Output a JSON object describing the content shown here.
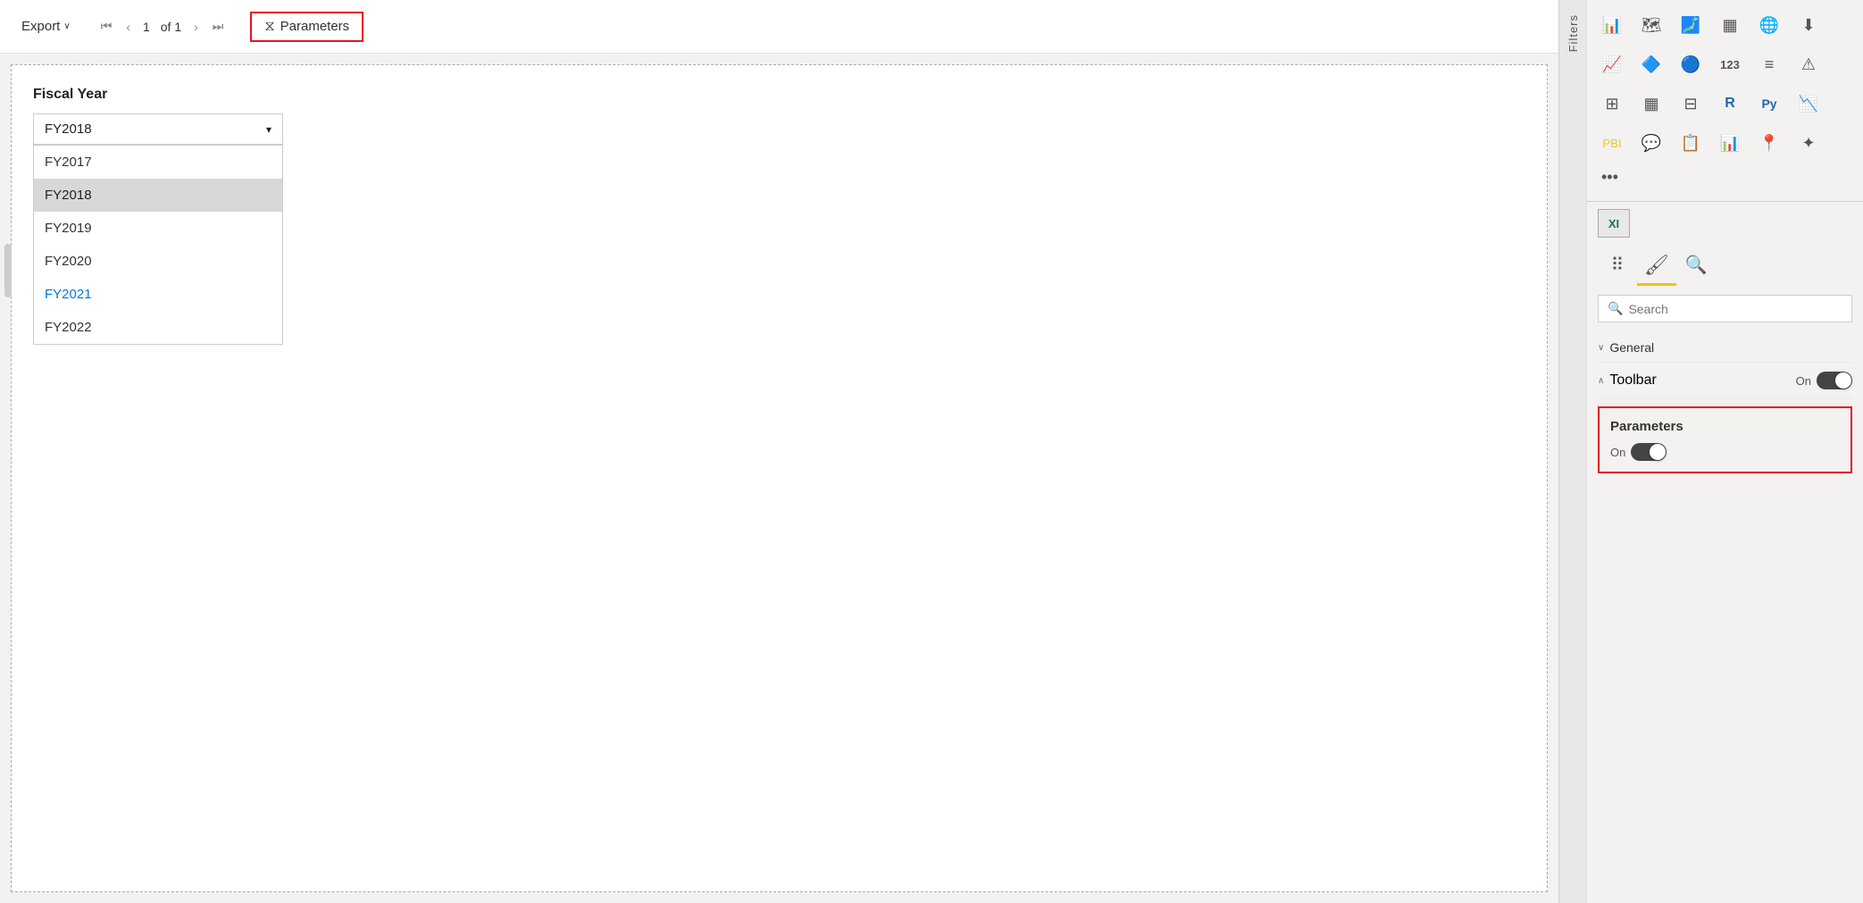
{
  "toolbar": {
    "export_label": "Export",
    "export_chevron": "∨",
    "page_number": "1",
    "page_of": "of 1",
    "parameters_label": "Parameters",
    "nav_first": "⏮",
    "nav_prev": "‹",
    "nav_next": "›",
    "nav_last": "⏭"
  },
  "fiscal": {
    "label": "Fiscal Year",
    "selected": "FY2018",
    "dropdown_arrow": "▾",
    "options": [
      {
        "value": "FY2017",
        "selected": false
      },
      {
        "value": "FY2018",
        "selected": true
      },
      {
        "value": "FY2019",
        "selected": false
      },
      {
        "value": "FY2020",
        "selected": false
      },
      {
        "value": "FY2021",
        "selected": false,
        "blue": true
      },
      {
        "value": "FY2022",
        "selected": false
      }
    ]
  },
  "sidebar": {
    "filters_label": "Filters",
    "excel_label": "XI",
    "tabs": [
      {
        "id": "fields",
        "label": "⠿"
      },
      {
        "id": "format",
        "label": "🖌",
        "active": true
      },
      {
        "id": "analytics",
        "label": "🔍"
      }
    ],
    "search_placeholder": "Search",
    "general_section": {
      "label": "General",
      "expanded": false
    },
    "toolbar_section": {
      "label": "Toolbar",
      "toggle_label": "On",
      "toggle_on": true
    },
    "parameters_section": {
      "title": "Parameters",
      "toggle_label": "On",
      "toggle_on": true
    }
  }
}
